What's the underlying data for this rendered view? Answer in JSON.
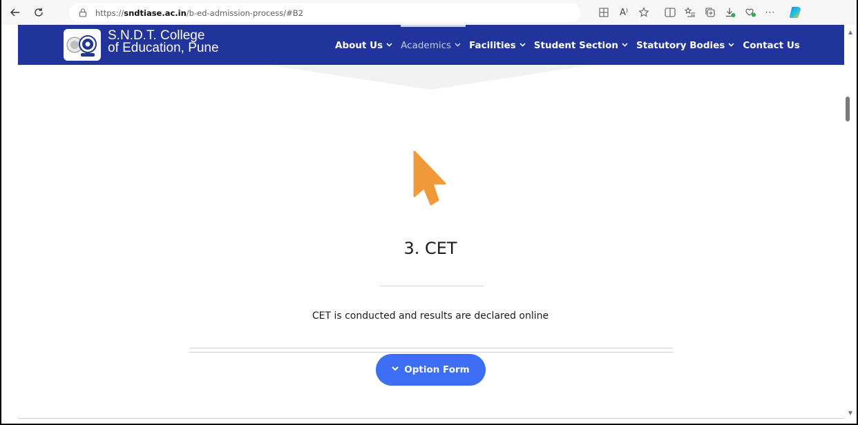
{
  "browser": {
    "url_prefix": "https://",
    "url_domain": "sndtiase.ac.in",
    "url_path": "/b-ed-admission-process/#B2",
    "icons": [
      "back-icon",
      "refresh-icon",
      "lock-icon",
      "apps-icon",
      "read-aloud-icon",
      "favorite-icon",
      "split-screen-icon",
      "favorites-list-icon",
      "collections-icon",
      "downloads-icon",
      "extensions-icon",
      "more-icon",
      "copilot-icon"
    ],
    "more_label": "···",
    "read_aloud_label": "A⁾"
  },
  "site": {
    "brand_line1": "S.N.D.T. College",
    "brand_line2": "of Education, Pune",
    "nav_color": "#20349c",
    "menu": [
      {
        "label": "About Us",
        "active": false
      },
      {
        "label": "Academics",
        "active": true
      },
      {
        "label": "Facilities",
        "active": false
      },
      {
        "label": "Student Section",
        "active": false
      },
      {
        "label": "Statutory Bodies",
        "active": false
      },
      {
        "label": "Contact Us",
        "active": false
      }
    ],
    "chevron": "⌄"
  },
  "content": {
    "step_title": "3. CET",
    "step_description": "CET is conducted and results are declared online",
    "button_label": "Option Form",
    "button_color": "#3d6ef5",
    "cursor_color": "#f0993b"
  }
}
